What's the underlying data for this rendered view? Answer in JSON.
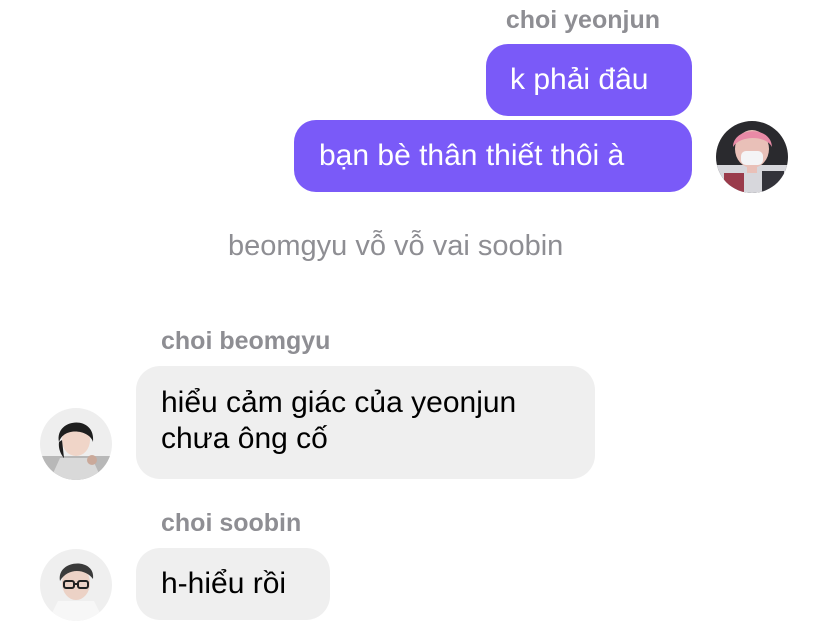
{
  "thread": {
    "group1": {
      "sender": "choi yeonjun",
      "messages": [
        "k phải đâu",
        "bạn bè thân thiết thôi à"
      ],
      "avatar_icon": "user-avatar-pink-hair"
    },
    "notice": "beomgyu vỗ vỗ vai soobin",
    "group2": {
      "sender": "choi beomgyu",
      "message_line1": "hiểu cảm giác của yeonjun",
      "message_line2": "chưa ông cố",
      "avatar_icon": "user-avatar-dark-hair"
    },
    "group3": {
      "sender": "choi soobin",
      "message": "h-hiểu rồi",
      "avatar_icon": "user-avatar-glasses"
    }
  },
  "colors": {
    "outgoing_bubble": "#7a5af8",
    "incoming_bubble": "#efefef",
    "meta_text": "#8e8e93"
  }
}
